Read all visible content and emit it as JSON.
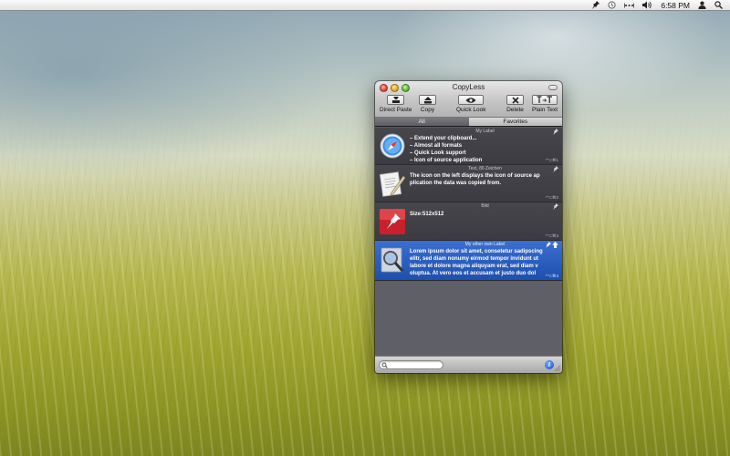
{
  "menubar": {
    "clock": "6:58 PM",
    "icons": [
      "pin-icon",
      "time-machine-icon",
      "dots-icon",
      "volume-icon",
      "user-icon",
      "spotlight-icon"
    ]
  },
  "window": {
    "title": "CopyLess",
    "toolbar": {
      "direct_paste": "Direct Paste",
      "copy": "Copy",
      "quick_look": "Quick Look",
      "delete": "Delete",
      "plain_text": "Plain Text"
    },
    "tabs": {
      "all": "All",
      "favorites": "Favorites"
    },
    "items": [
      {
        "label": "My Label",
        "lines": [
          "– Extend your clipboard...",
          "– Almost all formats",
          "– Quick Look support",
          "– Icon of source application"
        ],
        "shortcut": "^⌥⌘1",
        "icon": "safari-icon"
      },
      {
        "label": "Text, 86 Zeichen",
        "lines": [
          "The icon on the left displays the icon of source ap",
          "plication the data was copied from."
        ],
        "shortcut": "^⌥⌘2",
        "icon": "text-edit-icon"
      },
      {
        "label": "Bild",
        "lines": [
          "Size:512x512"
        ],
        "shortcut": "^⌥⌘3",
        "icon": "pushpin-app-icon"
      },
      {
        "label": "My other own Label",
        "lines": [
          "Lorem ipsum dolor sit amet, consetetur sadipscing",
          "elitr, sed diam nonumy eirmod tempor invidunt ut",
          "labore et dolore magna aliquyam erat, sed diam v",
          "oluptua. At vero eos et accusam et justo duo dol"
        ],
        "shortcut": "^⌥⌘4",
        "icon": "preview-app-icon",
        "selected": true
      }
    ],
    "search": {
      "placeholder": "",
      "value": ""
    },
    "info_label": "i"
  }
}
